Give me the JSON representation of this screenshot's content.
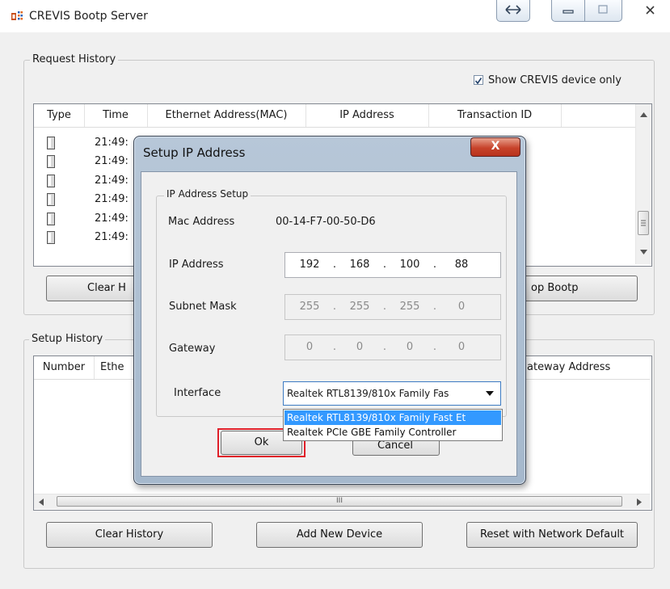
{
  "window": {
    "title": "CREVIS Bootp Server"
  },
  "request_history": {
    "group_label": "Request History",
    "show_crevis_only": {
      "label": "Show CREVIS device only",
      "checked": true
    },
    "columns": [
      "Type",
      "Time",
      "Ethernet Address(MAC)",
      "IP Address",
      "Transaction ID"
    ],
    "rows": [
      {
        "time": "21:49:"
      },
      {
        "time": "21:49:"
      },
      {
        "time": "21:49:"
      },
      {
        "time": "21:49:"
      },
      {
        "time": "21:49:"
      },
      {
        "time": "21:49:"
      }
    ],
    "clear_button": "Clear H",
    "stop_button": "op Bootp"
  },
  "setup_history": {
    "group_label": "Setup History",
    "columns": [
      "Number",
      "Ethe",
      "ateway Address"
    ],
    "scrollbar_grip": "III",
    "buttons": {
      "clear_history": "Clear History",
      "add_new_device": "Add New Device",
      "reset_default": "Reset with Network Default"
    }
  },
  "dialog": {
    "title": "Setup IP Address",
    "close_glyph": "X",
    "group_label": "IP Address Setup",
    "mac_label": "Mac Address",
    "mac_value": "00-14-F7-00-50-D6",
    "ip_label": "IP Address",
    "ip": [
      "192",
      "168",
      "100",
      "88"
    ],
    "subnet_label": "Subnet Mask",
    "subnet": [
      "255",
      "255",
      "255",
      "0"
    ],
    "gateway_label": "Gateway",
    "gateway": [
      "0",
      "0",
      "0",
      "0"
    ],
    "ip_dot": ".",
    "interface_label": "Interface",
    "interface_selected": "Realtek RTL8139/810x Family Fas",
    "interface_options": [
      "Realtek RTL8139/810x Family Fast Et",
      "Realtek PCIe GBE Family Controller"
    ],
    "ok_button": "Ok",
    "cancel_button": "Cancel"
  },
  "colors": {
    "selection_blue": "#3399ff",
    "highlight_red": "#e0202a",
    "close_red": "#c7432b"
  }
}
